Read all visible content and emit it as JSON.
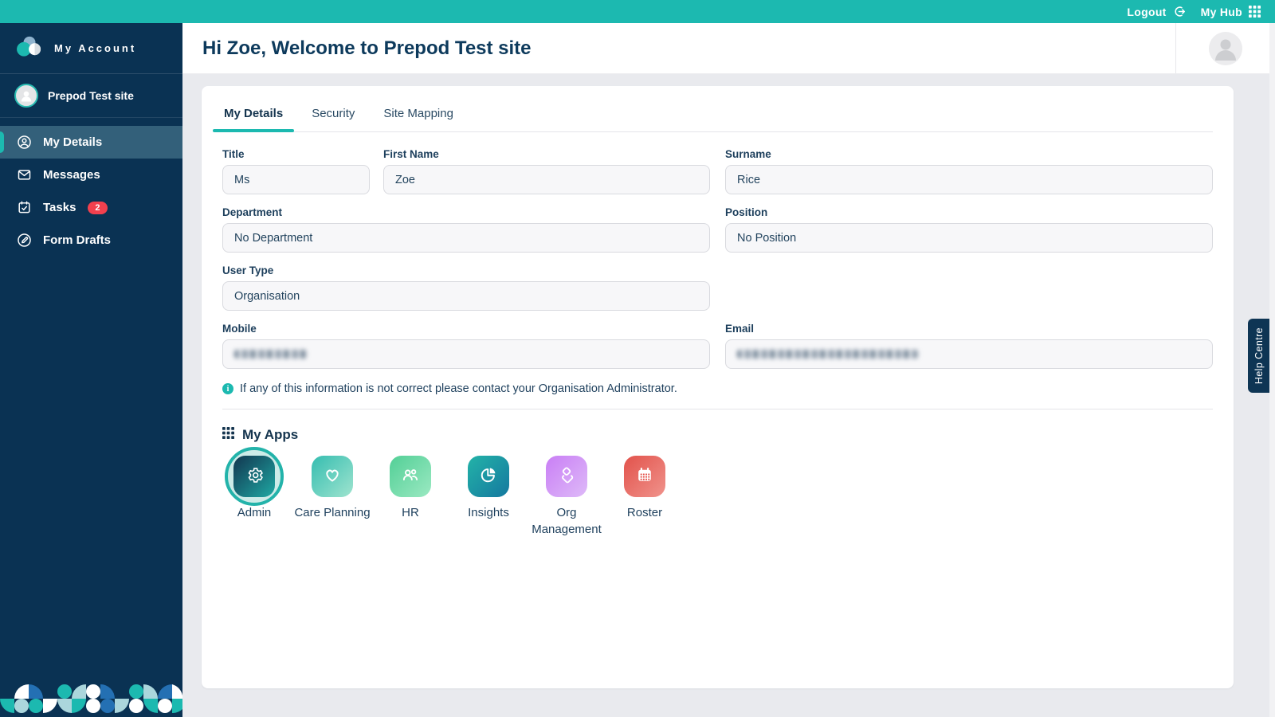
{
  "topbar": {
    "logout_label": "Logout",
    "myhub_label": "My Hub"
  },
  "sidebar": {
    "brand": "My Account",
    "site_name": "Prepod Test site",
    "menu": [
      {
        "label": "My Details",
        "icon": "person-circle-icon",
        "active": true
      },
      {
        "label": "Messages",
        "icon": "envelope-icon",
        "active": false
      },
      {
        "label": "Tasks",
        "icon": "calendar-check-icon",
        "active": false,
        "badge": "2"
      },
      {
        "label": "Form Drafts",
        "icon": "pencil-circle-icon",
        "active": false
      }
    ]
  },
  "header": {
    "title": "Hi Zoe, Welcome to Prepod Test site"
  },
  "tabs": [
    {
      "label": "My Details",
      "active": true
    },
    {
      "label": "Security",
      "active": false
    },
    {
      "label": "Site Mapping",
      "active": false
    }
  ],
  "form": {
    "title": {
      "label": "Title",
      "value": "Ms"
    },
    "first_name": {
      "label": "First Name",
      "value": "Zoe"
    },
    "surname": {
      "label": "Surname",
      "value": "Rice"
    },
    "department": {
      "label": "Department",
      "value": "No Department"
    },
    "position": {
      "label": "Position",
      "value": "No Position"
    },
    "user_type": {
      "label": "User Type",
      "value": "Organisation"
    },
    "mobile": {
      "label": "Mobile",
      "value": "",
      "redacted": true
    },
    "email": {
      "label": "Email",
      "value": "",
      "redacted": true
    },
    "info_note": "If any of this information is not correct please contact your Organisation Administrator."
  },
  "my_apps": {
    "title": "My Apps",
    "apps": [
      {
        "label": "Admin",
        "icon": "gear-icon",
        "gradient": [
          "#12354F",
          "#1FA9A4"
        ],
        "selected": true
      },
      {
        "label": "Care Planning",
        "icon": "heart-icon",
        "gradient": [
          "#35BDB0",
          "#9FE4CF"
        ],
        "selected": false
      },
      {
        "label": "HR",
        "icon": "people-icon",
        "gradient": [
          "#52CF96",
          "#9BE9C2"
        ],
        "selected": false
      },
      {
        "label": "Insights",
        "icon": "pie-chart-icon",
        "gradient": [
          "#23B3A8",
          "#15789F"
        ],
        "selected": false
      },
      {
        "label": "Org Management",
        "icon": "layers-icon",
        "gradient": [
          "#C97EF5",
          "#DEBAF8"
        ],
        "selected": false
      },
      {
        "label": "Roster",
        "icon": "calendar-icon",
        "gradient": [
          "#E2524B",
          "#F0938C"
        ],
        "selected": false
      }
    ]
  },
  "help_tab": {
    "label": "Help Centre"
  },
  "colors": {
    "accent_teal": "#1CB9B0",
    "navy": "#0A3253",
    "badge_red": "#F2404E"
  }
}
